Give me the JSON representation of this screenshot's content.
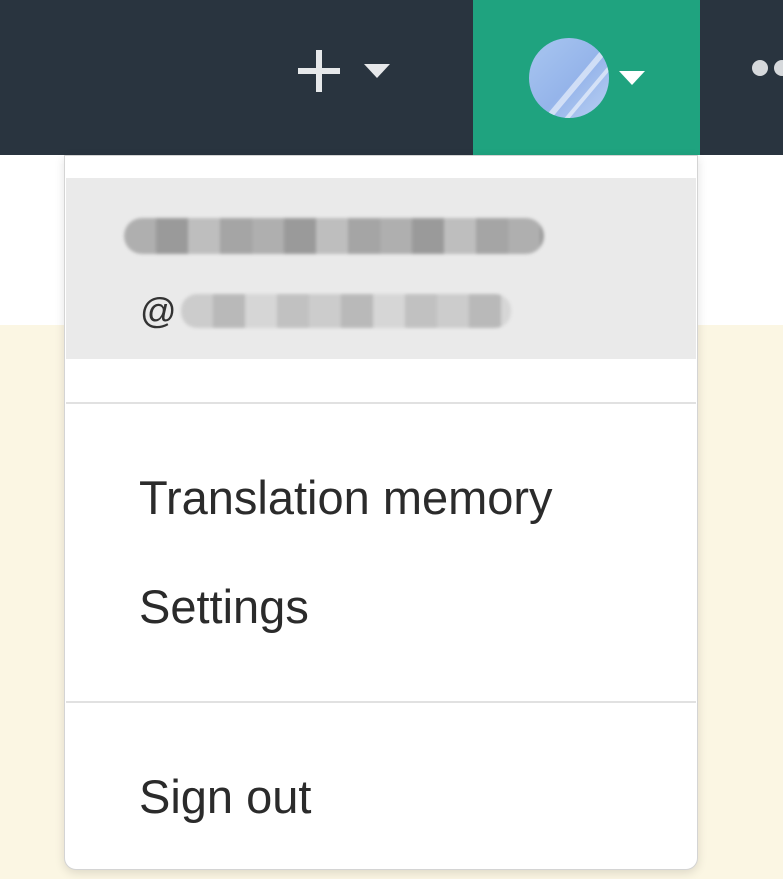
{
  "topbar": {
    "add_icon": "plus-icon",
    "add_menu_caret": "caret-down-icon",
    "avatar_icon": "user-avatar",
    "avatar_menu_caret": "caret-down-icon",
    "more_icon": "more-dots-icon",
    "background_color": "#29343f",
    "active_accent_color": "#1fa37f"
  },
  "user_menu": {
    "handle_prefix": "@",
    "items": [
      {
        "label": "Translation memory"
      },
      {
        "label": "Settings"
      }
    ],
    "sign_out_label": "Sign out"
  }
}
